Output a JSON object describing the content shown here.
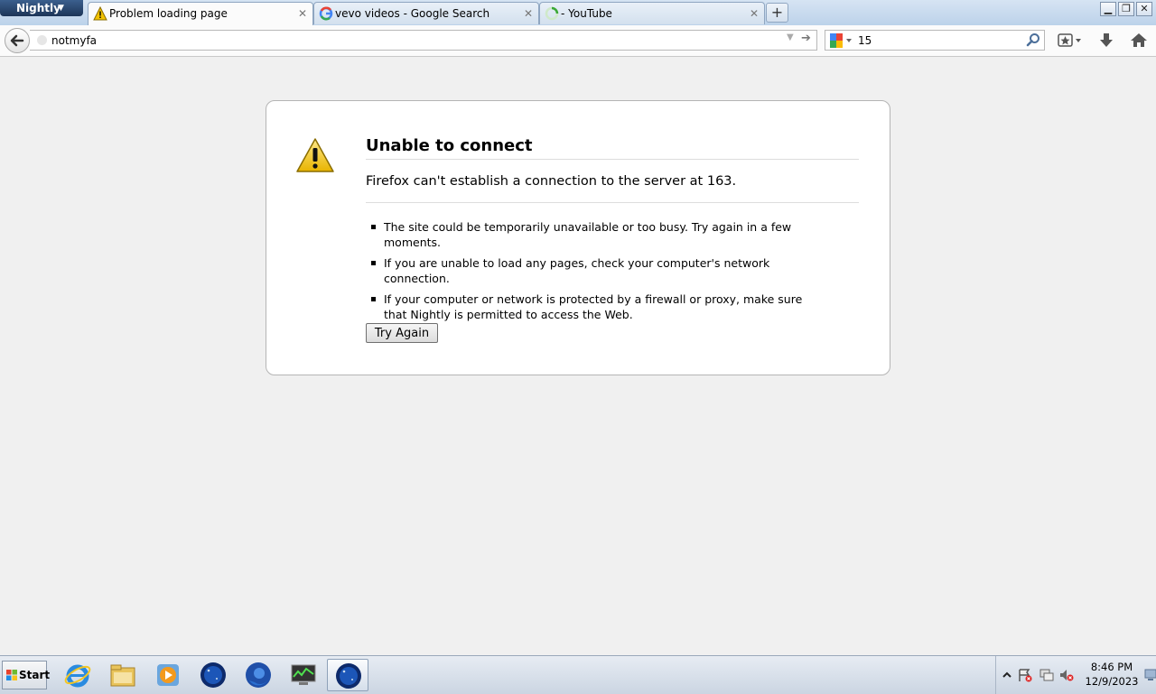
{
  "app": {
    "menu_label": "Nightly"
  },
  "tabs": [
    {
      "label": "Problem loading page",
      "icon": "warning-icon",
      "active": true
    },
    {
      "label": "vevo videos - Google Search",
      "icon": "google-icon",
      "active": false
    },
    {
      "label": "- YouTube",
      "icon": "loading-spinner-icon",
      "active": false
    }
  ],
  "navbar": {
    "url": "notmyfa",
    "search_value": "15",
    "search_engine_icon": "google-icon"
  },
  "error": {
    "title": "Unable to connect",
    "message": "Firefox can't establish a connection to the server at 163.",
    "tips": [
      "The site could be temporarily unavailable or too busy. Try again in a few moments.",
      "If you are unable to load any pages, check your computer's network connection.",
      "If your computer or network is protected by a firewall or proxy, make sure that Nightly is permitted to access the Web."
    ],
    "button_label": "Try Again"
  },
  "taskbar": {
    "start_label": "Start",
    "apps": [
      {
        "name": "internet-explorer-icon"
      },
      {
        "name": "file-explorer-icon"
      },
      {
        "name": "media-player-icon"
      },
      {
        "name": "nightly-icon"
      },
      {
        "name": "firefox-icon"
      },
      {
        "name": "task-manager-icon"
      },
      {
        "name": "nightly-icon",
        "active": true
      }
    ],
    "time": "8:46 PM",
    "date": "12/9/2023"
  },
  "colors": {
    "accent": "#1d3557",
    "warning": "#f2c200"
  }
}
